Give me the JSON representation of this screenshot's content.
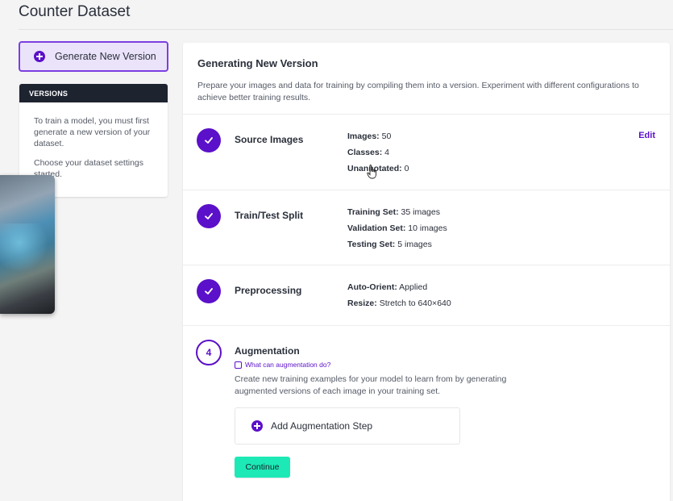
{
  "page": {
    "title": "Counter Dataset"
  },
  "sidebar": {
    "generate_label": "Generate New Version",
    "versions_header": "VERSIONS",
    "versions_text_1": "To train a model, you must first generate a new version of your dataset.",
    "versions_text_2": "Choose your dataset settings ‌ ‌ started."
  },
  "main": {
    "title": "Generating New Version",
    "description": "Prepare your images and data for training by compiling them into a version. Experiment with different configurations to achieve better training results.",
    "steps": [
      {
        "name": "Source Images",
        "edit_label": "Edit",
        "details": [
          {
            "key": "Images:",
            "value": "50"
          },
          {
            "key": "Classes:",
            "value": "4"
          },
          {
            "key": "Unannotated:",
            "value": "0"
          }
        ]
      },
      {
        "name": "Train/Test Split",
        "details": [
          {
            "key": "Training Set:",
            "value": "35 images"
          },
          {
            "key": "Validation Set:",
            "value": "10 images"
          },
          {
            "key": "Testing Set:",
            "value": "5 images"
          }
        ]
      },
      {
        "name": "Preprocessing",
        "details": [
          {
            "key": "Auto-Orient:",
            "value": "Applied"
          },
          {
            "key": "Resize:",
            "value": "Stretch to 640×640"
          }
        ]
      },
      {
        "number": "4",
        "name": "Augmentation",
        "help_link": "What can augmentation do?",
        "description": "Create new training examples for your model to learn from by generating augmented versions of each image in your training set.",
        "add_label": "Add Augmentation Step",
        "continue_label": "Continue"
      }
    ]
  },
  "colors": {
    "accent": "#5b10c9",
    "continue": "#1de9b6",
    "header_dark": "#1e2330"
  }
}
